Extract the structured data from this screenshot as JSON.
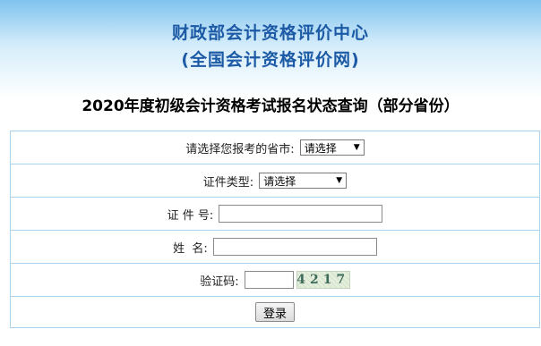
{
  "header": {
    "org_name": "财政部会计资格评价中心",
    "org_sub": "(全国会计资格评价网)",
    "page_title": "2020年度初级会计资格考试报名状态查询（部分省份）"
  },
  "form": {
    "province_label": "请选择您报考的省市:",
    "province_value": "请选择",
    "id_type_label": "证件类型:",
    "id_type_value": "请选择",
    "id_number_label": "证 件 号:",
    "id_number_value": "",
    "name_label": "姓  名:",
    "name_value": "",
    "captcha_label": "验证码:",
    "captcha_value": "",
    "captcha_image_text": "4217",
    "login_label": "登录"
  },
  "icons": {
    "dropdown": "chevron-down-icon"
  },
  "colors": {
    "title_blue": "#1c5aa6",
    "border": "#a9d3ee"
  }
}
